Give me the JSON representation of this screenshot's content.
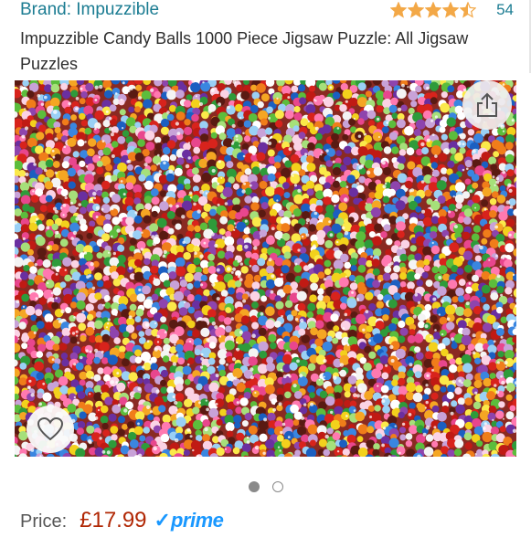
{
  "product": {
    "brand": "Brand: Impuzzible",
    "rating": 4.5,
    "rating_count": "54",
    "title": "Impuzzible Candy Balls 1000 Piece Jigsaw Puzzle: All Jigsaw Puzzles"
  },
  "gallery": {
    "image_count": 2,
    "active_index": 0,
    "share_icon": "share-icon",
    "favorite_icon": "heart-icon"
  },
  "pricing": {
    "label": "Price:",
    "value": "£17.99",
    "prime_check": "✓",
    "prime_label": "prime"
  },
  "colors": {
    "link": "#1b7c92",
    "price": "#b12704",
    "star": "#f3a847",
    "prime": "#1a98ff"
  }
}
